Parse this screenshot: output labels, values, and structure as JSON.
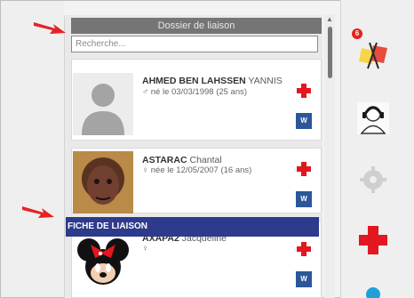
{
  "panel": {
    "title": "Dossier de liaison",
    "search_placeholder": "Recherche..."
  },
  "patients": [
    {
      "last": "AHMED BEN LAHSSEN",
      "first": "YANNIS",
      "sex": "♂",
      "born": "né le 03/03/1998 (25 ans)"
    },
    {
      "last": "ASTARAC",
      "first": "Chantal",
      "sex": "♀",
      "born": "née le 12/05/2007 (16 ans)"
    },
    {
      "last": "AXAPA2",
      "first": "Jacqueline",
      "sex": "♀",
      "born": ""
    }
  ],
  "overlay": {
    "banner_text": "FICHE DE LIAISON"
  },
  "right_bar": {
    "notification_count": "6"
  },
  "icons": {
    "doc": "W",
    "arrow": "red-arrow-icon"
  },
  "colors": {
    "banner": "#2e3a8b",
    "cross": "#e3171f",
    "word": "#2b579a"
  }
}
